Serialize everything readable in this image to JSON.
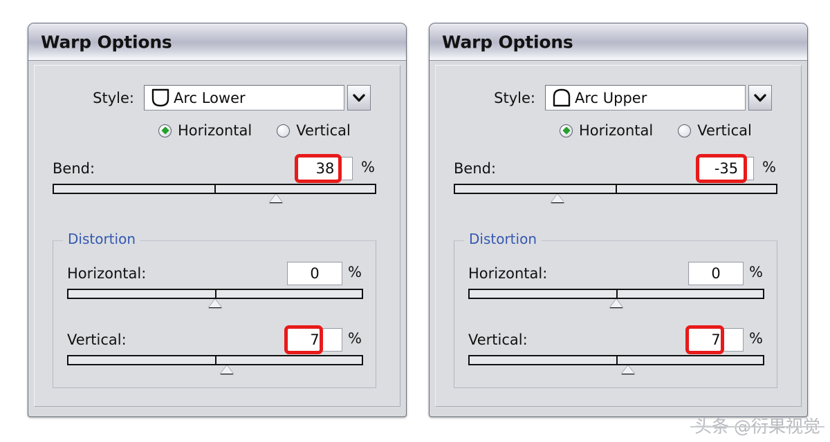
{
  "panels": [
    {
      "title": "Warp Options",
      "style": {
        "label": "Style:",
        "value": "Arc Lower",
        "icon": "arc-lower-icon"
      },
      "orientation": {
        "horizontal_label": "Horizontal",
        "vertical_label": "Vertical",
        "selected": "Horizontal"
      },
      "bend": {
        "label": "Bend:",
        "value": "38",
        "unit": "%",
        "highlighted": true,
        "thumb_percent": 69
      },
      "distortion": {
        "title": "Distortion",
        "horizontal": {
          "label": "Horizontal:",
          "value": "0",
          "unit": "%",
          "highlighted": false,
          "thumb_percent": 50
        },
        "vertical": {
          "label": "Vertical:",
          "value": "7",
          "unit": "%",
          "highlighted": true,
          "thumb_percent": 54
        }
      }
    },
    {
      "title": "Warp Options",
      "style": {
        "label": "Style:",
        "value": "Arc Upper",
        "icon": "arc-upper-icon"
      },
      "orientation": {
        "horizontal_label": "Horizontal",
        "vertical_label": "Vertical",
        "selected": "Horizontal"
      },
      "bend": {
        "label": "Bend:",
        "value": "-35",
        "unit": "%",
        "highlighted": true,
        "thumb_percent": 32
      },
      "distortion": {
        "title": "Distortion",
        "horizontal": {
          "label": "Horizontal:",
          "value": "0",
          "unit": "%",
          "highlighted": false,
          "thumb_percent": 50
        },
        "vertical": {
          "label": "Vertical:",
          "value": "7",
          "unit": "%",
          "highlighted": true,
          "thumb_percent": 54
        }
      }
    }
  ],
  "watermark": {
    "source": "头条",
    "handle": "@衍果视觉"
  },
  "colors": {
    "highlight_red": "#e81a1a",
    "group_title_blue": "#3458b0",
    "radio_green": "#25a02a",
    "dialog_face": "#dcdde1"
  }
}
